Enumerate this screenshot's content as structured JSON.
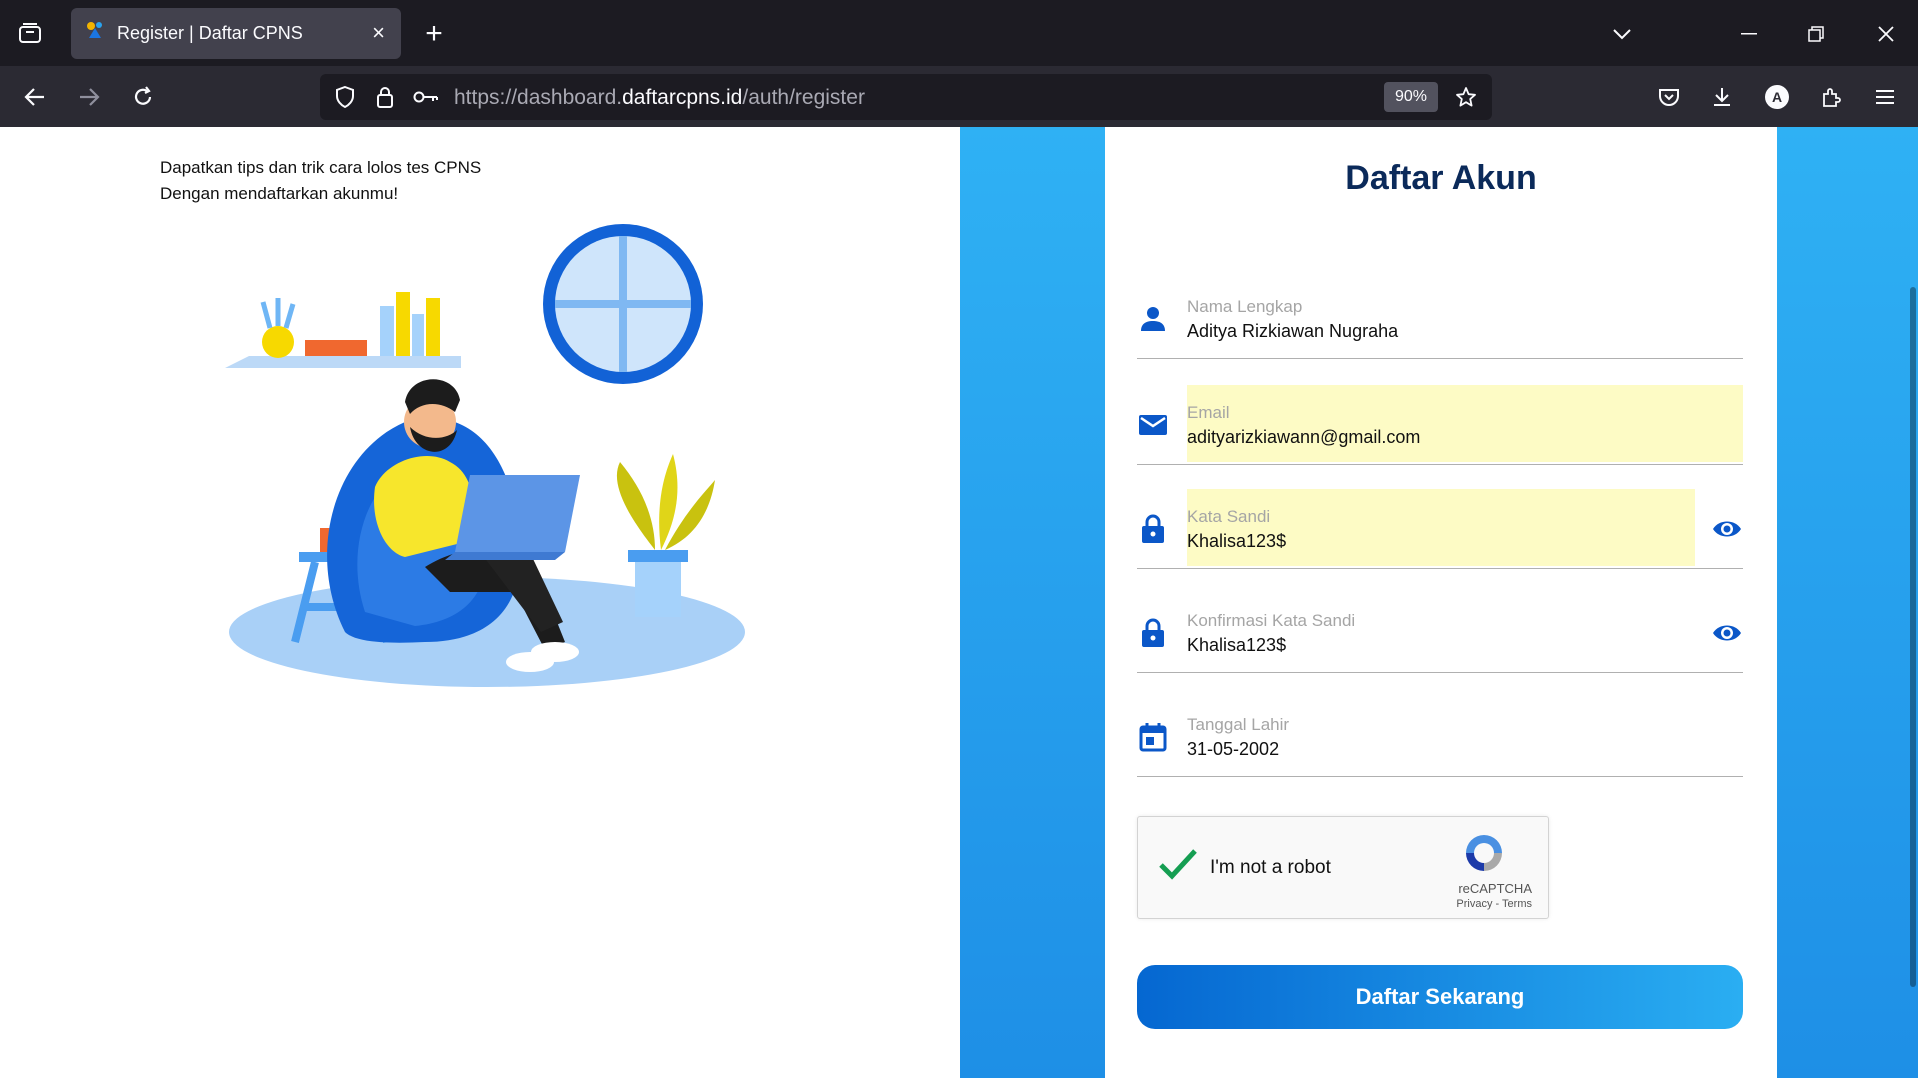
{
  "browser": {
    "tab_title": "Register | Daftar CPNS",
    "url_prefix": "https://dashboard.",
    "url_domain": "daftarcpns.id",
    "url_path": "/auth/register",
    "zoom": "90%",
    "profile_initial": "A"
  },
  "promo": {
    "line1": "Dapatkan tips dan trik cara lolos tes CPNS",
    "line2": "Dengan mendaftarkan akunmu!"
  },
  "form": {
    "title": "Daftar Akun",
    "full_name": {
      "label": "Nama Lengkap",
      "value": "Aditya Rizkiawan Nugraha"
    },
    "email": {
      "label": "Email",
      "value": "adityarizkiawann@gmail.com"
    },
    "password": {
      "label": "Kata Sandi",
      "value": "Khalisa123$"
    },
    "confirm_password": {
      "label": "Konfirmasi Kata Sandi",
      "value": "Khalisa123$"
    },
    "birth_date": {
      "label": "Tanggal Lahir",
      "value": "31-05-2002"
    },
    "captcha": {
      "label": "I'm not a robot",
      "brand": "reCAPTCHA",
      "links": "Privacy - Terms",
      "checked": true
    },
    "submit_label": "Daftar Sekarang"
  },
  "colors": {
    "accent": "#0b57c8",
    "title": "#0b2a5a",
    "autofill": "#fdfbc5",
    "panel": "#2fb1f4"
  }
}
